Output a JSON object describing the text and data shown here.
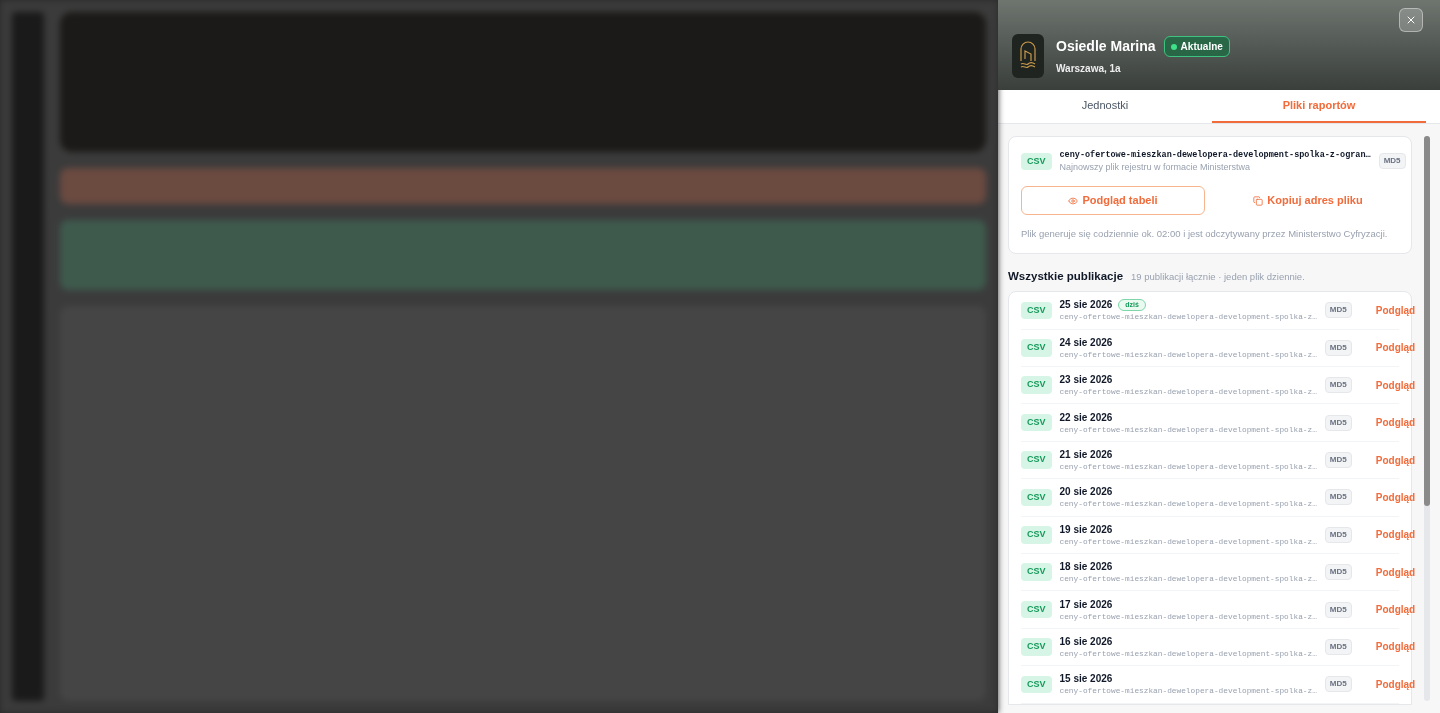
{
  "panel": {
    "title": "Osiedle Marina",
    "status": "Aktualne",
    "location": "Warszawa, 1a"
  },
  "tabs": [
    {
      "label": "Jednostki",
      "selected": false
    },
    {
      "label": "Pliki raportów",
      "selected": true
    }
  ],
  "latest_file": {
    "type": "CSV",
    "filename": "ceny-ofertowe-mieszkan-dewelopera-development-spolka-z-ogran…",
    "description": "Najnowszy plik rejestru w formacie Ministerstwa",
    "checksum": "MD5",
    "preview_button": "Podgląd tabeli",
    "copy_button": "Kopiuj adres pliku",
    "note": "Plik generuje się codziennie ok. 02:00 i jest odczytywany przez Ministerstwo Cyfryzacji."
  },
  "publications": {
    "title": "Wszystkie publikacje",
    "summary": "19 publikacji łącznie · jeden plik dziennie.",
    "rows": [
      {
        "type": "CSV",
        "date": "25 sie 2026",
        "badge": "dziś",
        "filename": "ceny-ofertowe-mieszkan-dewelopera-development-spolka-z…",
        "checksum": "MD5",
        "action": "Podgląd"
      },
      {
        "type": "CSV",
        "date": "24 sie 2026",
        "filename": "ceny-ofertowe-mieszkan-dewelopera-development-spolka-z…",
        "checksum": "MD5",
        "action": "Podgląd"
      },
      {
        "type": "CSV",
        "date": "23 sie 2026",
        "filename": "ceny-ofertowe-mieszkan-dewelopera-development-spolka-z…",
        "checksum": "MD5",
        "action": "Podgląd"
      },
      {
        "type": "CSV",
        "date": "22 sie 2026",
        "filename": "ceny-ofertowe-mieszkan-dewelopera-development-spolka-z…",
        "checksum": "MD5",
        "action": "Podgląd"
      },
      {
        "type": "CSV",
        "date": "21 sie 2026",
        "filename": "ceny-ofertowe-mieszkan-dewelopera-development-spolka-z…",
        "checksum": "MD5",
        "action": "Podgląd"
      },
      {
        "type": "CSV",
        "date": "20 sie 2026",
        "filename": "ceny-ofertowe-mieszkan-dewelopera-development-spolka-z…",
        "checksum": "MD5",
        "action": "Podgląd"
      },
      {
        "type": "CSV",
        "date": "19 sie 2026",
        "filename": "ceny-ofertowe-mieszkan-dewelopera-development-spolka-z…",
        "checksum": "MD5",
        "action": "Podgląd"
      },
      {
        "type": "CSV",
        "date": "18 sie 2026",
        "filename": "ceny-ofertowe-mieszkan-dewelopera-development-spolka-z…",
        "checksum": "MD5",
        "action": "Podgląd"
      },
      {
        "type": "CSV",
        "date": "17 sie 2026",
        "filename": "ceny-ofertowe-mieszkan-dewelopera-development-spolka-z…",
        "checksum": "MD5",
        "action": "Podgląd"
      },
      {
        "type": "CSV",
        "date": "16 sie 2026",
        "filename": "ceny-ofertowe-mieszkan-dewelopera-development-spolka-z…",
        "checksum": "MD5",
        "action": "Podgląd"
      },
      {
        "type": "CSV",
        "date": "15 sie 2026",
        "filename": "ceny-ofertowe-mieszkan-dewelopera-development-spolka-z…",
        "checksum": "MD5",
        "action": "Podgląd"
      }
    ]
  }
}
